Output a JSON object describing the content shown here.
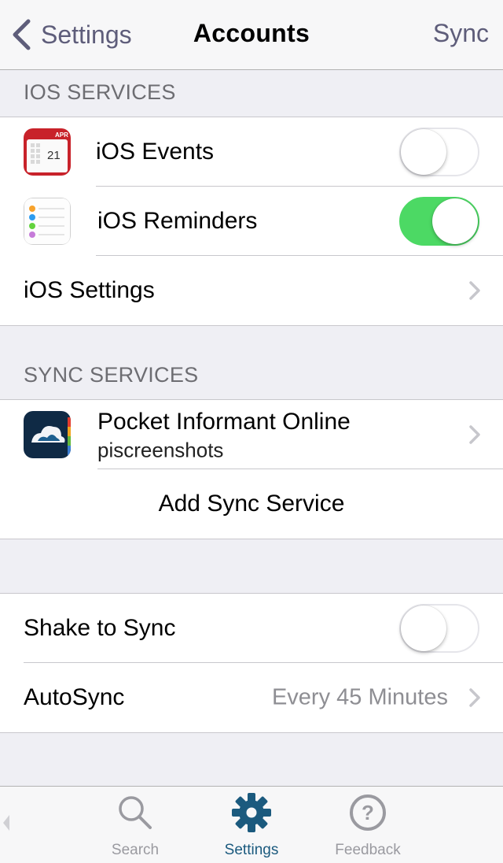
{
  "nav": {
    "back_label": "Settings",
    "title": "Accounts",
    "right_label": "Sync"
  },
  "ios_section": {
    "header": "IOS SERVICES",
    "events": {
      "label": "iOS Events",
      "toggle_on": false,
      "icon": "calendar-icon",
      "icon_month": "APR",
      "icon_day": "21"
    },
    "reminders": {
      "label": "iOS Reminders",
      "toggle_on": true,
      "icon": "reminders-icon"
    },
    "settings": {
      "label": "iOS Settings"
    }
  },
  "sync_section": {
    "header": "SYNC SERVICES",
    "service": {
      "title": "Pocket Informant Online",
      "subtitle": "piscreenshots",
      "icon": "pocket-informant-icon"
    },
    "add_label": "Add Sync Service"
  },
  "options_section": {
    "shake": {
      "label": "Shake to Sync",
      "toggle_on": false
    },
    "autosync": {
      "label": "AutoSync",
      "value": "Every 45 Minutes"
    }
  },
  "tabbar": {
    "tabs": [
      {
        "label": "Search",
        "icon": "search-icon",
        "active": false
      },
      {
        "label": "Settings",
        "icon": "gear-icon",
        "active": true
      },
      {
        "label": "Feedback",
        "icon": "question-icon",
        "active": false
      }
    ]
  },
  "colors": {
    "accent": "#5e5d7a",
    "toggle_on": "#4cd964",
    "tab_active": "#1b5a7e",
    "background": "#efeff4"
  }
}
